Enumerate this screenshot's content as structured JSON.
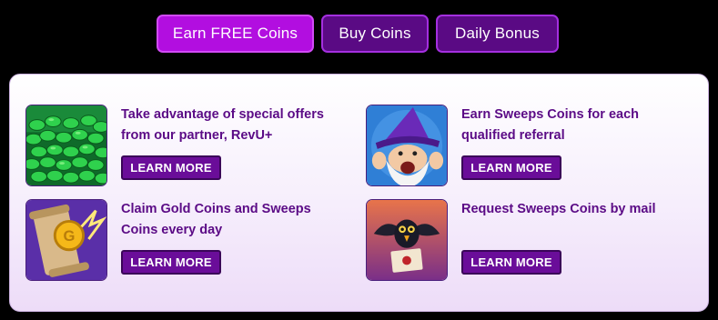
{
  "tabs": [
    {
      "label": "Earn FREE Coins",
      "active": true
    },
    {
      "label": "Buy Coins",
      "active": false
    },
    {
      "label": "Daily Bonus",
      "active": false
    }
  ],
  "offers": [
    {
      "text": "Take advantage of special offers from our partner, RevU+",
      "button": "LEARN MORE",
      "icon": "green-coins-icon"
    },
    {
      "text": "Earn Sweeps Coins for each qualified referral",
      "button": "LEARN MORE",
      "icon": "wizard-icon"
    },
    {
      "text": "Claim Gold Coins and Sweeps Coins every day",
      "button": "LEARN MORE",
      "icon": "scroll-coin-icon"
    },
    {
      "text": "Request Sweeps Coins by mail",
      "button": "LEARN MORE",
      "icon": "crow-letter-icon"
    }
  ],
  "colors": {
    "active_tab": "#b20ee0",
    "inactive_tab": "#5a0a84",
    "text_purple": "#5b0b86",
    "button": "#6a0d99"
  }
}
